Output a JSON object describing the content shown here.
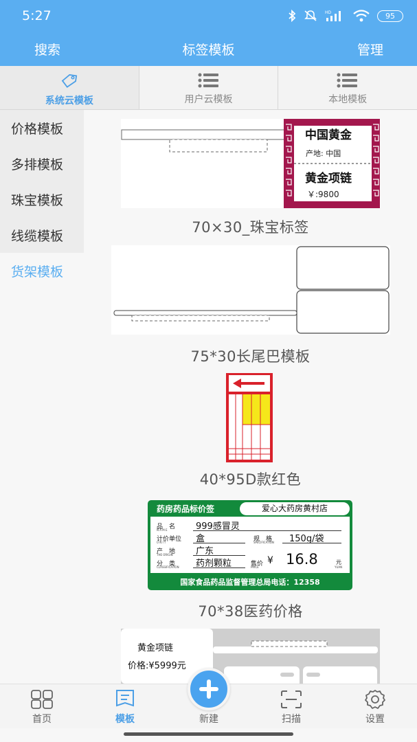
{
  "status_bar": {
    "time": "5:27",
    "battery": "95"
  },
  "header": {
    "left_label": "搜索",
    "title": "标签模板",
    "right_label": "管理"
  },
  "tabs": [
    {
      "label": "系统云模板",
      "icon": "tag-icon",
      "active": true
    },
    {
      "label": "用户云模板",
      "icon": "list-icon",
      "active": false
    },
    {
      "label": "本地模板",
      "icon": "list-icon",
      "active": false
    }
  ],
  "sidebar": {
    "items": [
      {
        "label": "价格模板",
        "active": false
      },
      {
        "label": "多排模板",
        "active": false
      },
      {
        "label": "珠宝模板",
        "active": false
      },
      {
        "label": "线缆模板",
        "active": false
      },
      {
        "label": "货架模板",
        "active": true
      }
    ]
  },
  "templates": [
    {
      "name": "70×30_珠宝标签",
      "preview": {
        "brand": "中国黄金",
        "origin": "产地: 中国",
        "product": "黄金项链",
        "price": "￥:9800"
      }
    },
    {
      "name": "75*30长尾巴模板"
    },
    {
      "name": "40*95D款红色"
    },
    {
      "name": "70*38医药价格",
      "preview": {
        "header_title": "药房药品标价签",
        "store": "爱心大药房黄村店",
        "name_label": "品　名",
        "name_sub": "N A M E",
        "name_value": "999感冒灵",
        "unit_label": "计价单位",
        "unit_sub": "U N I T",
        "unit_value": "盒",
        "spec_label": "规　格",
        "spec_sub": "SPECIFICATION",
        "spec_value": "150g/袋",
        "origin_label": "产　地",
        "origin_sub": "THE ORIGIN",
        "origin_value": "广东",
        "class_label": "分　类",
        "class_sub": "CLASSIFICATION",
        "class_value": "药剂颗粒",
        "price_label": "售价",
        "price_sub": "PRICE",
        "currency": "¥",
        "price_value": "16.8",
        "price_unit": "元",
        "price_unit_sub": "YUAN",
        "footer": "国家食品药品监督管理总局电话：12358"
      }
    },
    {
      "name": "",
      "preview": {
        "product": "黄金项链",
        "price": "价格:¥5999元"
      }
    }
  ],
  "bottom_nav": {
    "items": [
      {
        "label": "首页",
        "icon": "home-grid-icon"
      },
      {
        "label": "模板",
        "icon": "template-icon",
        "active": true
      },
      {
        "label": "新建",
        "icon": "plus-icon"
      },
      {
        "label": "扫描",
        "icon": "scan-icon"
      },
      {
        "label": "设置",
        "icon": "gear-icon"
      }
    ]
  },
  "colors": {
    "primary": "#5aaef1",
    "active_text": "#4c9fe6",
    "jewelry_frame": "#a3174d",
    "med_green": "#138a3c",
    "red_label": "#d9212b",
    "yellow": "#f5e71a"
  }
}
